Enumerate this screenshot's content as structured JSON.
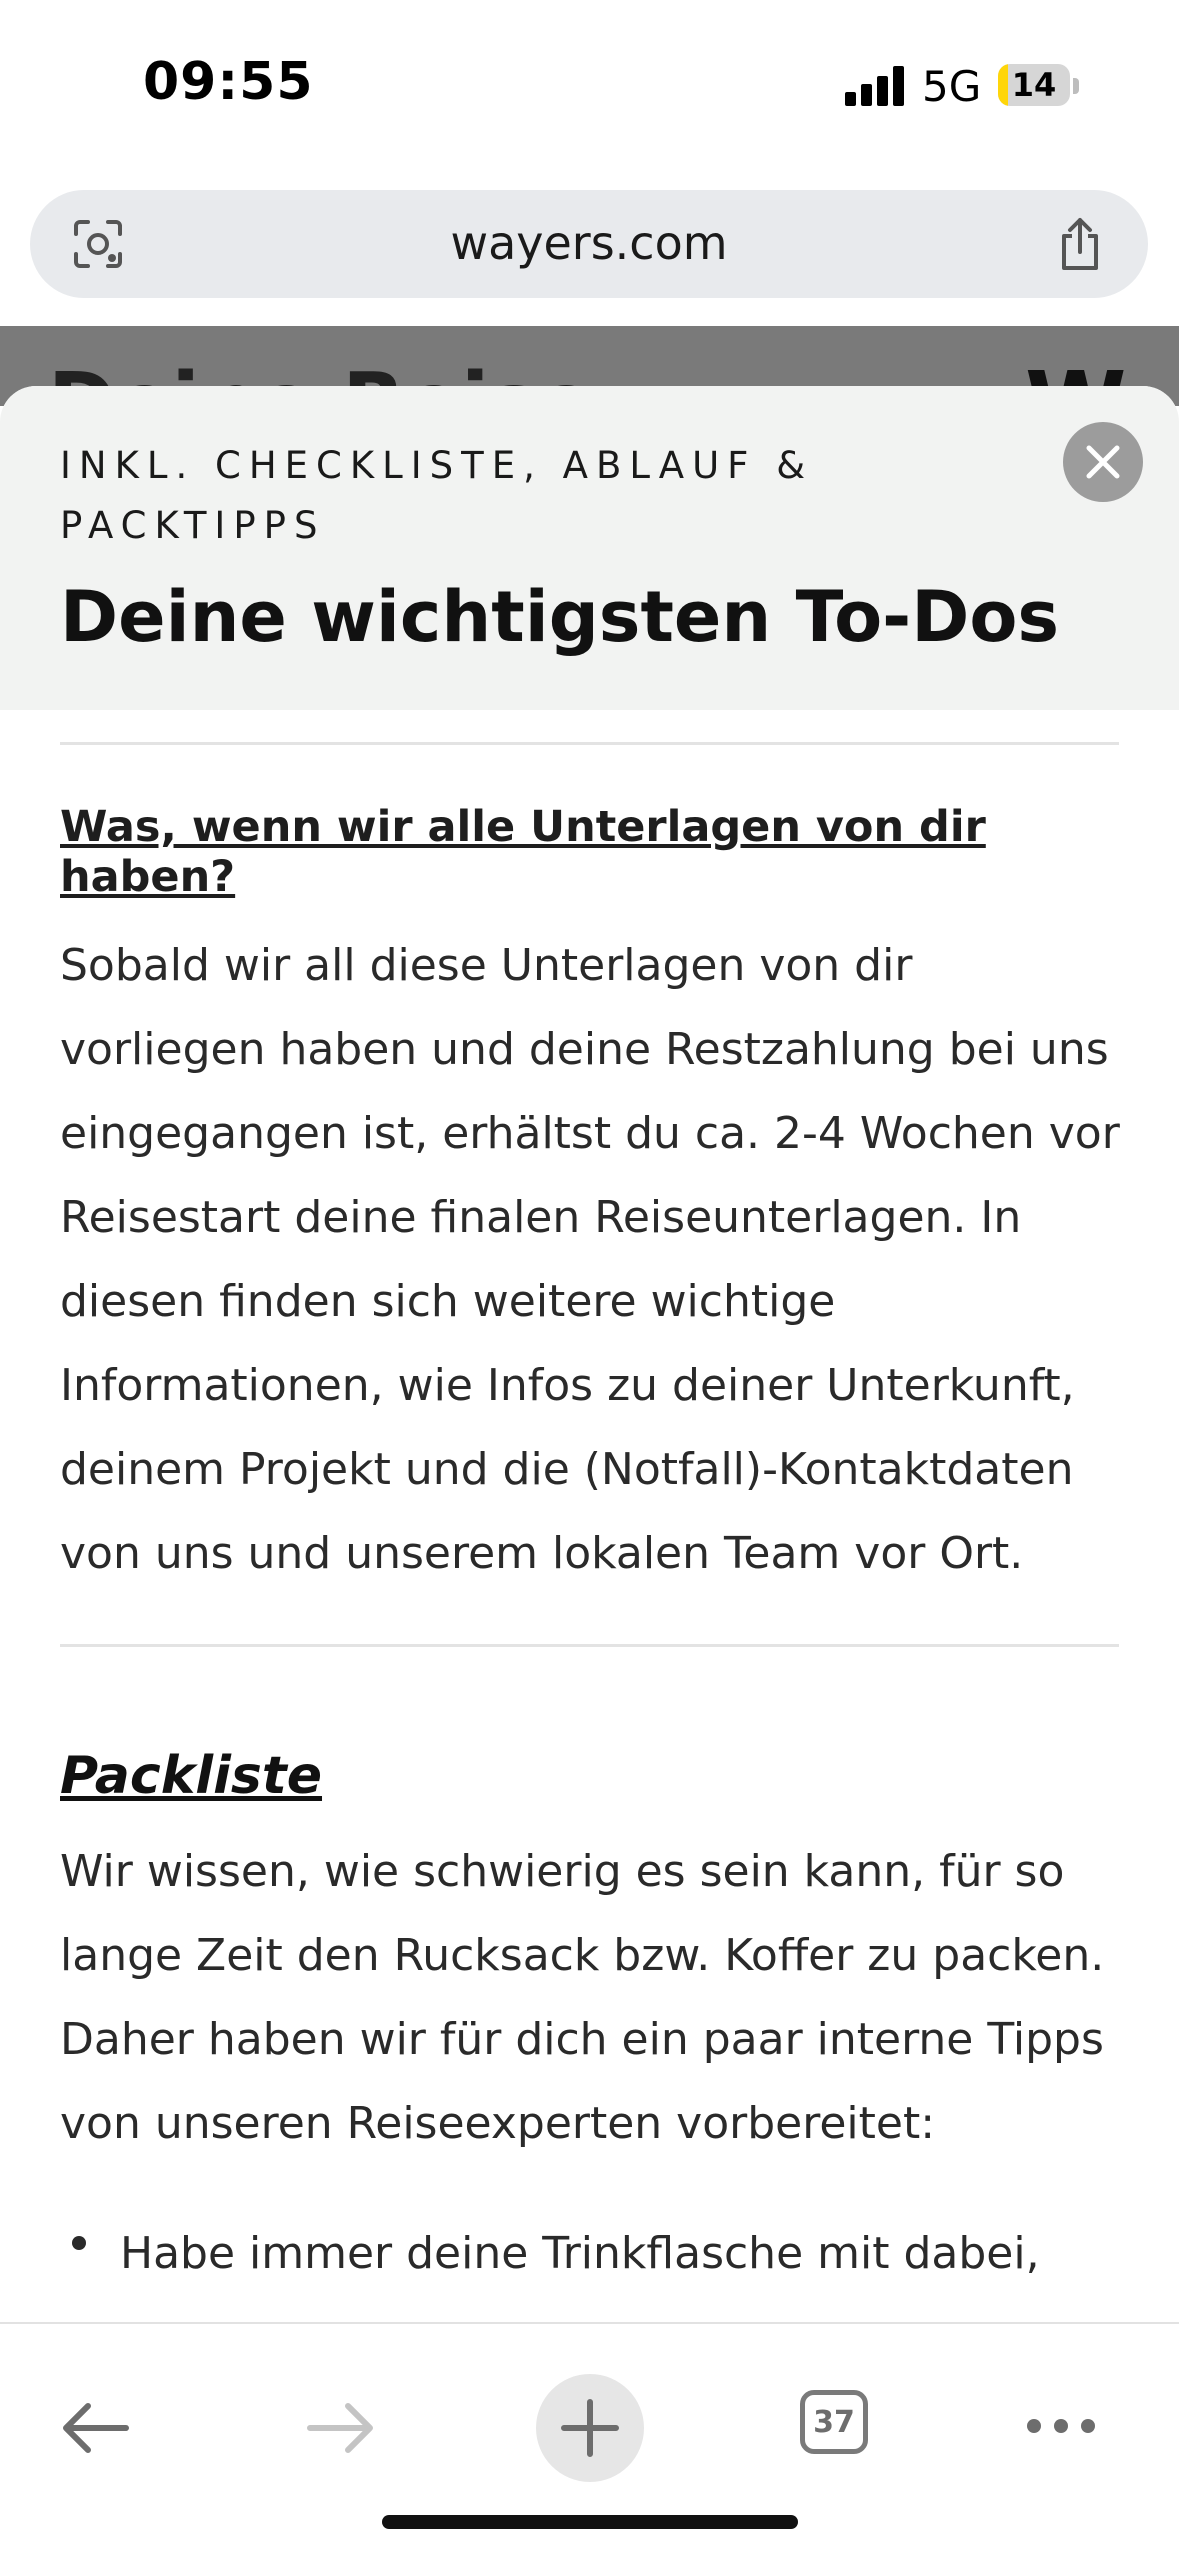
{
  "status_bar": {
    "time": "09:55",
    "network": "5G",
    "battery": "14",
    "battery_level": 0.14
  },
  "browser": {
    "url": "wayers.com",
    "tabs_count": "37"
  },
  "background_page": {
    "title": "Deine Reise",
    "logo": "W"
  },
  "modal": {
    "kicker": "INKL. CHECKLISTE, ABLAUF & PACKTIPPS",
    "title": "Deine wichtigsten To-Dos",
    "section1": {
      "heading": "Was, wenn wir alle Unterlagen von dir haben?",
      "text": "Sobald wir all diese Unterlagen von dir vorliegen haben und deine Restzahlung bei uns eingegangen ist, erhältst du ca. 2-4 Wochen vor Reisestart deine finalen Reiseunterlagen. In diesen finden sich weitere wichtige Informationen, wie Infos zu deiner Unterkunft, deinem Projekt und die (Notfall)-Kontaktdaten von uns und unserem lokalen Team vor Ort."
    },
    "section2": {
      "heading": "Packliste",
      "text": "Wir wissen, wie schwierig es sein kann, für so lange Zeit den Rucksack bzw. Koffer zu packen. Daher haben wir für dich ein paar interne Tipps von unseren Reiseexperten vorbereitet:",
      "bullets": [
        "Habe immer deine Trinkflasche mit dabei,"
      ]
    }
  },
  "icons": {
    "lens": "camera-lens-icon",
    "share": "share-icon",
    "close": "close-icon",
    "back": "back-arrow-icon",
    "forward": "forward-arrow-icon",
    "plus": "plus-icon",
    "more": "more-dots-icon"
  }
}
